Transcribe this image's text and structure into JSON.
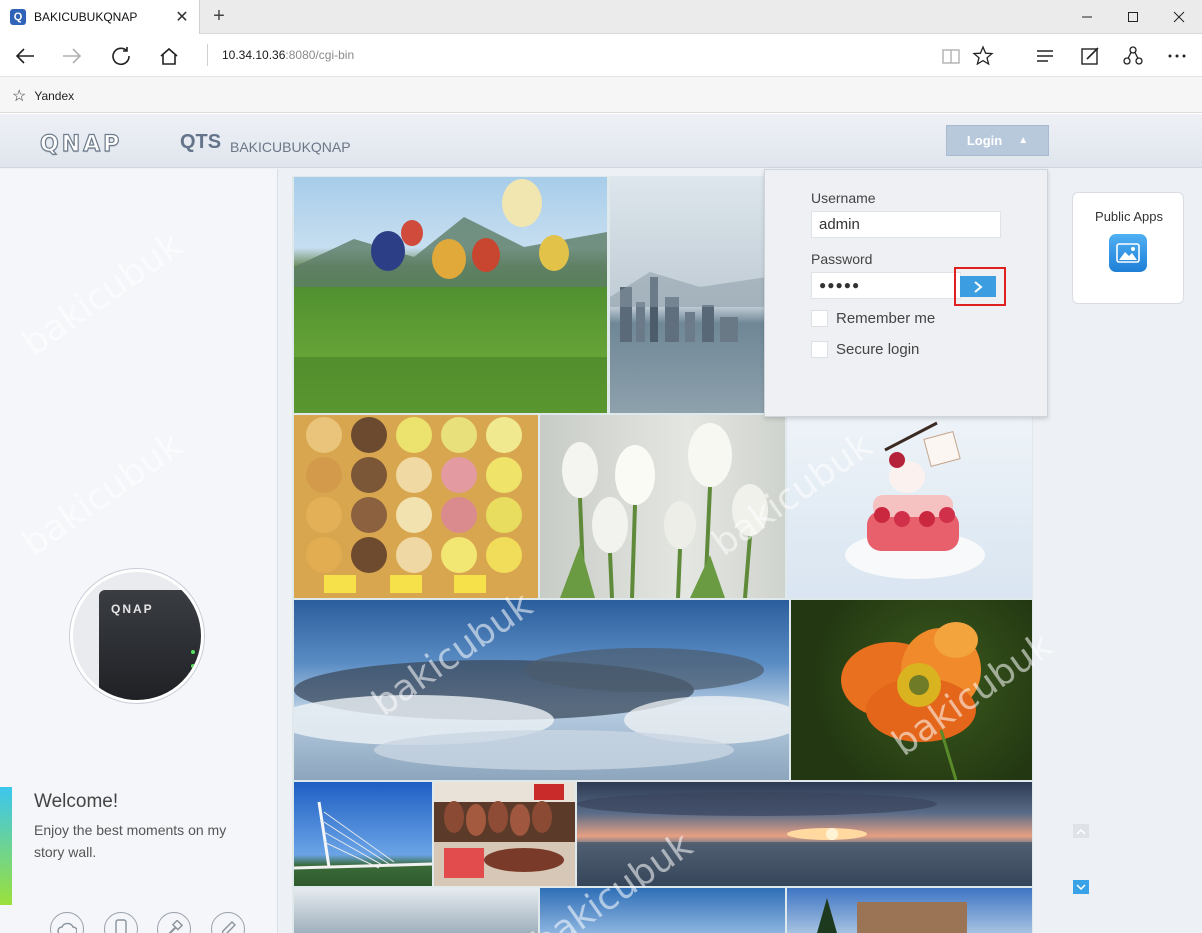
{
  "browser": {
    "tab_title": "BAKICUBUKQNAP",
    "tab_favicon": "Q",
    "url_host": "10.34.10.36",
    "url_rest": ":8080/cgi-bin",
    "favorites": [
      {
        "label": "Yandex"
      }
    ]
  },
  "header": {
    "logo": "QNAP",
    "product": "QTS",
    "hostname": "BAKICUBUKQNAP",
    "login_label": "Login"
  },
  "login_panel": {
    "username_label": "Username",
    "username_value": "admin",
    "password_label": "Password",
    "password_value": "●●●●●",
    "remember_label": "Remember me",
    "secure_label": "Secure login"
  },
  "public_apps": {
    "label": "Public Apps"
  },
  "left_panel": {
    "nas_label": "QNAP",
    "welcome": "Welcome!",
    "subtitle": "Enjoy the best moments on my story wall.",
    "icons": [
      "cloud-icon",
      "mobile-icon",
      "tools-icon",
      "edit-icon"
    ]
  },
  "watermark": "bakicubuk",
  "colors": {
    "accent_blue": "#3c9ee0",
    "highlight_red": "#e02020",
    "login_button": "#b8c9dc"
  }
}
